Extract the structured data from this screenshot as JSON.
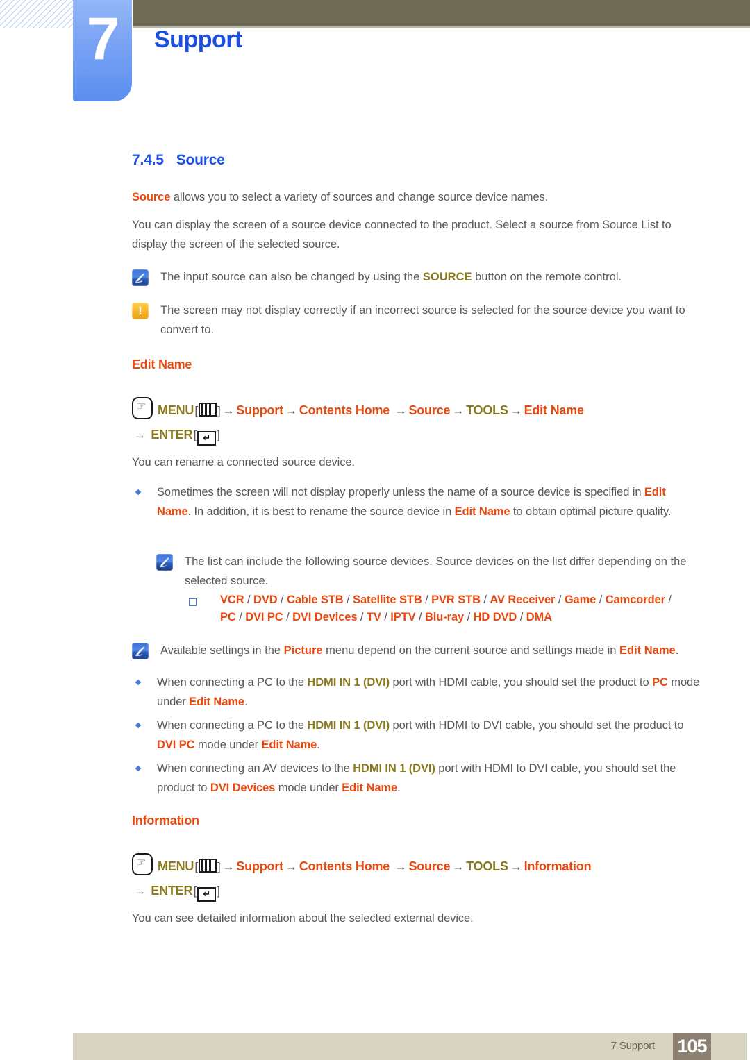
{
  "header": {
    "chapter_number": "7",
    "chapter_title": "Support",
    "accent_blue": "#1a4fe0",
    "tab_blue": "#7ba4f5",
    "bar_olive": "#6e6b55"
  },
  "section": {
    "number": "7.4.5",
    "title": "Source"
  },
  "intro": {
    "p1_a": "Source",
    "p1_b": " allows you to select a variety of sources and change source device names.",
    "p2": "You can display the screen of a source device connected to the product. Select a source from Source List to display the screen of the selected source."
  },
  "notes": {
    "note1_a": "The input source can also be changed by using the ",
    "note1_b": "SOURCE",
    "note1_c": " button on the remote control.",
    "note2": "The screen may not display correctly if an incorrect source is selected for the source device you want to convert to.",
    "note3": "The list can include the following source devices. Source devices on the list differ depending on the selected source.",
    "note4_a": "Available settings in the ",
    "note4_b": "Picture",
    "note4_c": " menu depend on the current source and settings made in ",
    "note4_d": "Edit Name",
    "note4_e": "."
  },
  "edit_name": {
    "heading": "Edit Name",
    "menu_path": {
      "hand_icon": "hand-press-icon",
      "menu_label": "MENU",
      "menu_key_icon": "menu-key-icon",
      "arrow": "→",
      "steps": [
        "Support",
        "Contents Home",
        "Source",
        "TOOLS",
        "Edit Name"
      ],
      "enter_label": "ENTER",
      "enter_key_icon": "enter-key-icon",
      "bracket_open": "[",
      "bracket_close": "]"
    },
    "description": "You can rename a connected source device.",
    "bullet1_a": "Sometimes the screen will not display properly unless the name of a source device is specified in ",
    "bullet1_b": "Edit Name",
    "bullet1_c": ". In addition, it is best to rename the source device in ",
    "bullet1_d": "Edit Name",
    "bullet1_e": " to obtain optimal picture quality.",
    "device_list_line1": [
      "VCR",
      "DVD",
      "Cable STB",
      "Satellite STB",
      "PVR STB",
      "AV Receiver",
      "Game",
      "Camcorder"
    ],
    "device_list_line2": [
      "PC",
      "DVI PC",
      "DVI Devices",
      "TV",
      "IPTV",
      "Blu-ray",
      "HD DVD",
      "DMA"
    ],
    "bullet2_a": "When connecting a PC to the ",
    "bullet2_b": "HDMI IN 1 (DVI)",
    "bullet2_c": " port with HDMI cable, you should set the product to ",
    "bullet2_d": "PC",
    "bullet2_e": " mode under ",
    "bullet2_f": "Edit Name",
    "bullet2_g": ".",
    "bullet3_a": "When connecting a PC to the ",
    "bullet3_b": "HDMI IN 1 (DVI)",
    "bullet3_c": " port with HDMI to DVI cable, you should set the product to ",
    "bullet3_d": "DVI PC",
    "bullet3_e": " mode under ",
    "bullet3_f": "Edit Name",
    "bullet3_g": ".",
    "bullet4_a": "When connecting an AV devices to the ",
    "bullet4_b": "HDMI IN 1 (DVI)",
    "bullet4_c": " port with HDMI to DVI cable, you should set the product to ",
    "bullet4_d": "DVI Devices",
    "bullet4_e": " mode under ",
    "bullet4_f": "Edit Name",
    "bullet4_g": "."
  },
  "information": {
    "heading": "Information",
    "menu_path": {
      "menu_label": "MENU",
      "steps": [
        "Support",
        "Contents Home",
        "Source",
        "TOOLS",
        "Information"
      ],
      "enter_label": "ENTER"
    },
    "description": "You can see detailed information about the selected external device."
  },
  "footer": {
    "label": "7 Support",
    "page_number": "105",
    "bar_color": "#d9d4c2",
    "page_box_color": "#8c8073"
  }
}
